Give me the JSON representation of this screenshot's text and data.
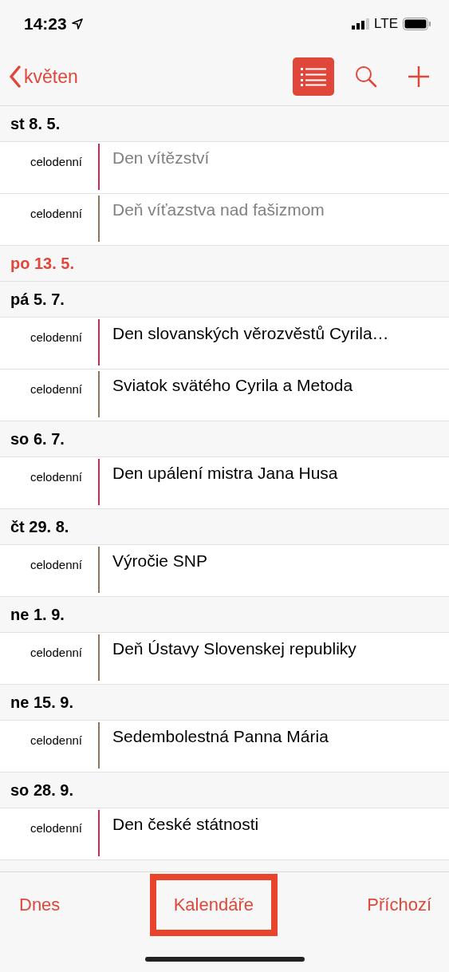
{
  "status_bar": {
    "time": "14:23",
    "network": "LTE"
  },
  "nav": {
    "back_label": "květen",
    "list_view_selected": true
  },
  "days": [
    {
      "date": "st 8. 5.",
      "today": false,
      "events": [
        {
          "time": "celodenní",
          "title": "Den vítězství",
          "past": true,
          "color": "#d0245a"
        },
        {
          "time": "celodenní",
          "title": "Deň víťazstva nad fašizmom",
          "past": true,
          "color": "#8e7555"
        }
      ]
    },
    {
      "date": "po 13. 5.",
      "today": true
    },
    {
      "date": "pá 5. 7.",
      "today": false,
      "events": [
        {
          "time": "celodenní",
          "title": "Den slovanských věrozvěstů Cyrila…",
          "past": false,
          "color": "#d0245a"
        },
        {
          "time": "celodenní",
          "title": "Sviatok svätého Cyrila a Metoda",
          "past": false,
          "color": "#8e7555"
        }
      ]
    },
    {
      "date": "so 6. 7.",
      "today": false,
      "events": [
        {
          "time": "celodenní",
          "title": "Den upálení mistra Jana Husa",
          "past": false,
          "color": "#d0245a"
        }
      ]
    },
    {
      "date": "čt 29. 8.",
      "today": false,
      "events": [
        {
          "time": "celodenní",
          "title": "Výročie SNP",
          "past": false,
          "color": "#8e7555"
        }
      ]
    },
    {
      "date": "ne 1. 9.",
      "today": false,
      "events": [
        {
          "time": "celodenní",
          "title": "Deň Ústavy Slovenskej republiky",
          "past": false,
          "color": "#8e7555"
        }
      ]
    },
    {
      "date": "ne 15. 9.",
      "today": false,
      "events": [
        {
          "time": "celodenní",
          "title": "Sedembolestná Panna Mária",
          "past": false,
          "color": "#8e7555"
        }
      ]
    },
    {
      "date": "so 28. 9.",
      "today": false,
      "events": [
        {
          "time": "celodenní",
          "title": "Den české státnosti",
          "past": false,
          "color": "#d0245a"
        }
      ]
    }
  ],
  "toolbar": [
    {
      "label": "Dnes",
      "highlighted": false
    },
    {
      "label": "Kalendáře",
      "highlighted": true
    },
    {
      "label": "Příchozí",
      "highlighted": false
    }
  ]
}
